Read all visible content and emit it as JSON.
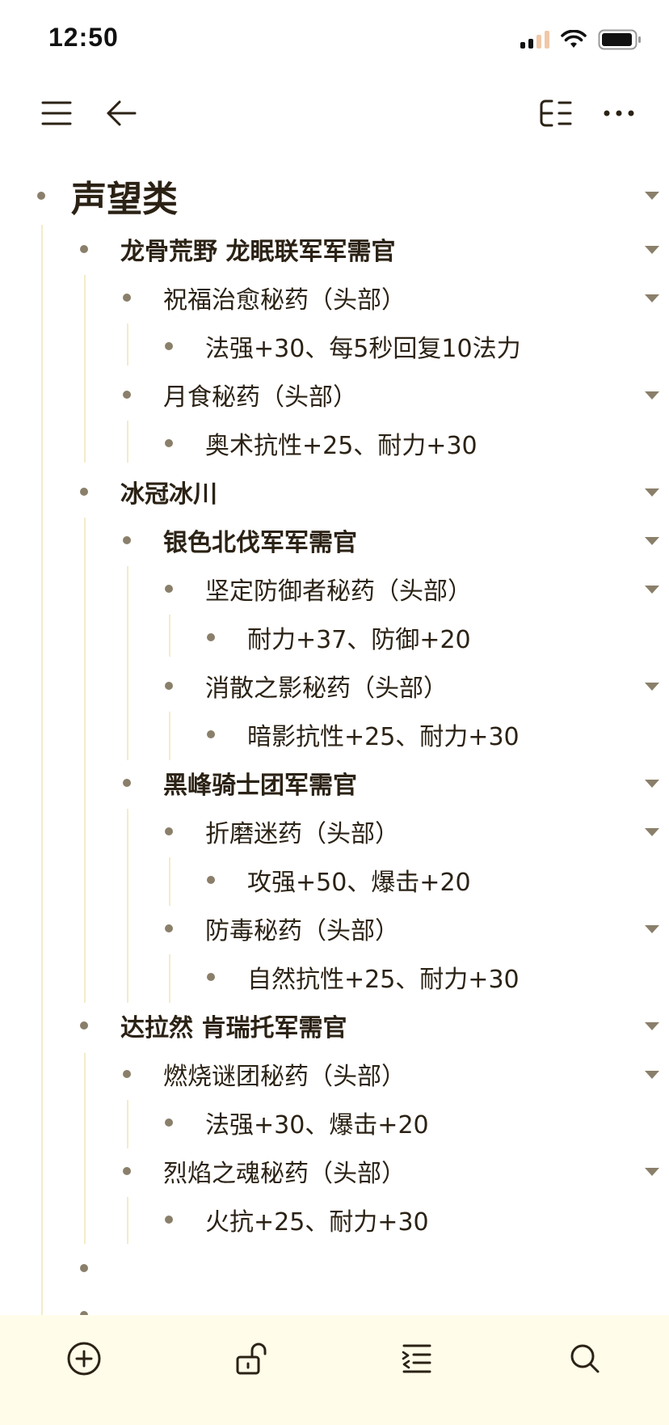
{
  "status_bar": {
    "time": "12:50"
  },
  "toolbar": {
    "left_icons": [
      "menu-icon",
      "back-arrow-icon"
    ],
    "right_icons": [
      "outline-view-icon",
      "more-icon"
    ]
  },
  "outline": {
    "items": [
      {
        "text": "声望类"
      },
      {
        "text": "龙骨荒野 龙眠联军军需官"
      },
      {
        "text": "祝福治愈秘药（头部）"
      },
      {
        "text": "法强+30、每5秒回复10法力"
      },
      {
        "text": "月食秘药（头部）"
      },
      {
        "text": "奥术抗性+25、耐力+30"
      },
      {
        "text": "冰冠冰川"
      },
      {
        "text": "银色北伐军军需官"
      },
      {
        "text": "坚定防御者秘药（头部）"
      },
      {
        "text": "耐力+37、防御+20"
      },
      {
        "text": "消散之影秘药（头部）"
      },
      {
        "text": "暗影抗性+25、耐力+30"
      },
      {
        "text": "黑峰骑士团军需官"
      },
      {
        "text": "折磨迷药（头部）"
      },
      {
        "text": "攻强+50、爆击+20"
      },
      {
        "text": "防毒秘药（头部）"
      },
      {
        "text": "自然抗性+25、耐力+30"
      },
      {
        "text": "达拉然 肯瑞托军需官"
      },
      {
        "text": "燃烧谜团秘药（头部）"
      },
      {
        "text": "法强+30、爆击+20"
      },
      {
        "text": "烈焰之魂秘药（头部）"
      },
      {
        "text": "火抗+25、耐力+30"
      },
      {
        "text": ""
      },
      {
        "text": ""
      }
    ]
  },
  "bottom_bar": {
    "icons": [
      "add-icon",
      "unlock-icon",
      "indent-icon",
      "search-icon"
    ]
  },
  "colors": {
    "accent": "#8a7f6a",
    "bottom_bar_bg": "#fffdea",
    "guide_line": "#f3ecc9"
  }
}
